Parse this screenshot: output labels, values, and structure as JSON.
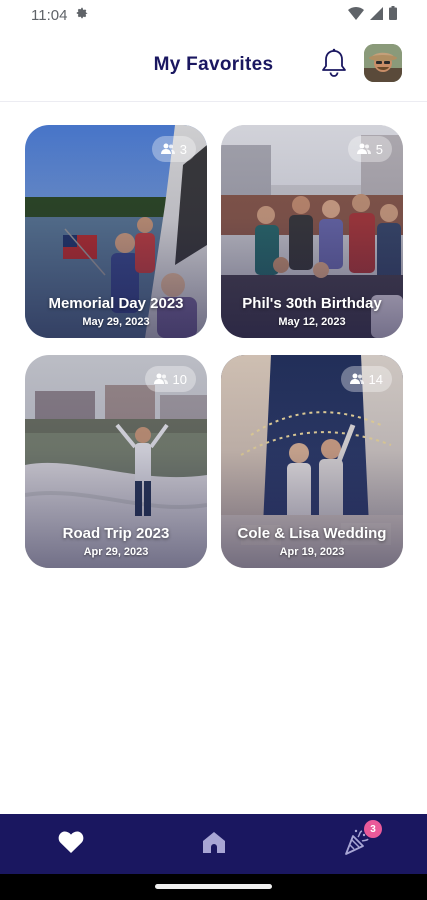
{
  "status_bar": {
    "time": "11:04",
    "icons": [
      "settings-icon",
      "wifi-icon",
      "signal-icon",
      "battery-icon"
    ]
  },
  "header": {
    "title": "My Favorites",
    "notification_icon": "bell-icon",
    "avatar": "user-avatar"
  },
  "albums": [
    {
      "title": "Memorial Day 2023",
      "date": "May 29, 2023",
      "count": "3"
    },
    {
      "title": "Phil's 30th Birthday",
      "date": "May 12, 2023",
      "count": "5"
    },
    {
      "title": "Road Trip 2023",
      "date": "Apr 29, 2023",
      "count": "10"
    },
    {
      "title": "Cole & Lisa Wedding",
      "date": "Apr 19, 2023",
      "count": "14"
    }
  ],
  "bottom_nav": {
    "items": [
      {
        "icon": "heart-icon",
        "active": true
      },
      {
        "icon": "home-icon",
        "active": false
      },
      {
        "icon": "party-popper-icon",
        "active": false,
        "badge": "3"
      }
    ]
  },
  "colors": {
    "brand": "#1a1760",
    "badge": "#ea5a9a"
  }
}
